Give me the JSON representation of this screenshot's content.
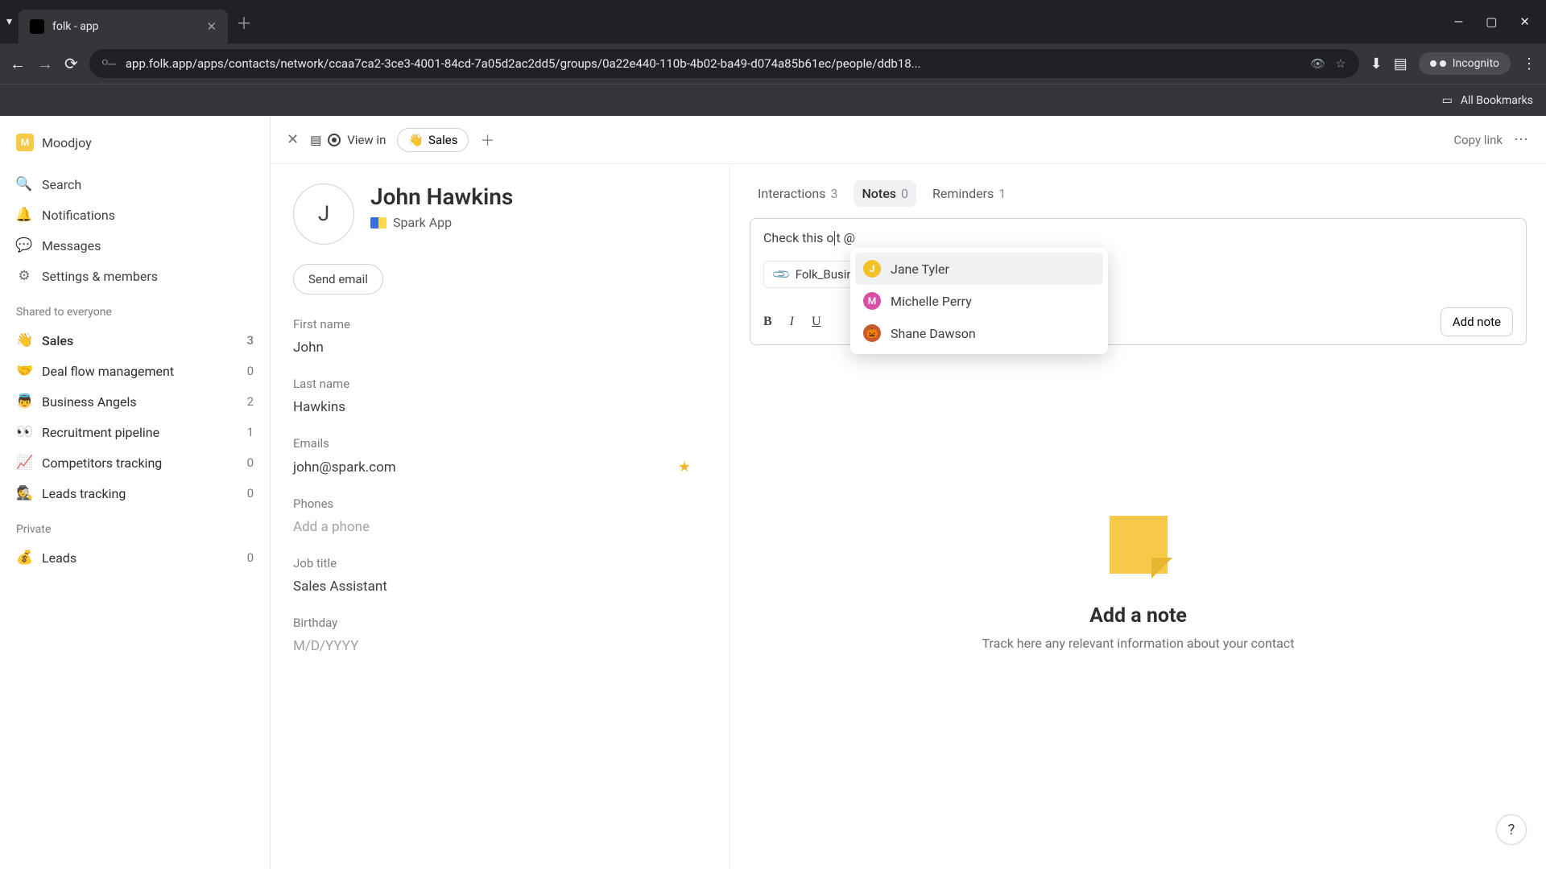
{
  "browser": {
    "tab_title": "folk - app",
    "url_display": "app.folk.app/apps/contacts/network/ccaa7ca2-3ce3-4001-84cd-7a05d2ac2dd5/groups/0a22e440-110b-4b02-ba49-d074a85b61ec/people/ddb18...",
    "incognito_label": "Incognito",
    "bookmarks_label": "All Bookmarks"
  },
  "sidebar": {
    "workspace": "Moodjoy",
    "nav": {
      "search": "Search",
      "notifications": "Notifications",
      "messages": "Messages",
      "settings": "Settings & members"
    },
    "sections": {
      "shared_title": "Shared to everyone",
      "private_title": "Private"
    },
    "groups": [
      {
        "emoji": "👋",
        "label": "Sales",
        "count": "3"
      },
      {
        "emoji": "🤝",
        "label": "Deal flow management",
        "count": "0"
      },
      {
        "emoji": "👼",
        "label": "Business Angels",
        "count": "2"
      },
      {
        "emoji": "👀",
        "label": "Recruitment pipeline",
        "count": "1"
      },
      {
        "emoji": "📈",
        "label": "Competitors tracking",
        "count": "0"
      },
      {
        "emoji": "🕵️",
        "label": "Leads tracking",
        "count": "0"
      }
    ],
    "private_groups": [
      {
        "emoji": "💰",
        "label": "Leads",
        "count": "0"
      }
    ]
  },
  "panel_header": {
    "view_in_label": "View in",
    "chip_emoji": "👋",
    "chip_label": "Sales",
    "copy_link": "Copy link"
  },
  "contact": {
    "initial": "J",
    "name": "John Hawkins",
    "company": "Spark App",
    "send_email_btn": "Send email",
    "fields": {
      "first_name_label": "First name",
      "first_name": "John",
      "last_name_label": "Last name",
      "last_name": "Hawkins",
      "emails_label": "Emails",
      "email": "john@spark.com",
      "phones_label": "Phones",
      "phones_placeholder": "Add a phone",
      "job_label": "Job title",
      "job": "Sales Assistant",
      "birthday_label": "Birthday",
      "birthday_placeholder": "M/D/YYYY"
    }
  },
  "tabs": {
    "interactions_label": "Interactions",
    "interactions_count": "3",
    "notes_label": "Notes",
    "notes_count": "0",
    "reminders_label": "Reminders",
    "reminders_count": "1"
  },
  "note_editor": {
    "text_before": "Check this o",
    "text_after": "t @",
    "attachment_label": "Folk_Busin",
    "add_note_btn": "Add note"
  },
  "mentions": [
    {
      "name": "Jane Tyler",
      "color": "#f3c22b",
      "initial": "J",
      "highlight": true
    },
    {
      "name": "Michelle Perry",
      "color": "#d84fa4",
      "initial": "M",
      "highlight": false
    },
    {
      "name": "Shane Dawson",
      "color": "#c85a2e",
      "initial": "🎃",
      "highlight": false
    }
  ],
  "empty_state": {
    "title": "Add a note",
    "subtitle": "Track here any relevant information about your contact"
  },
  "help": "?"
}
